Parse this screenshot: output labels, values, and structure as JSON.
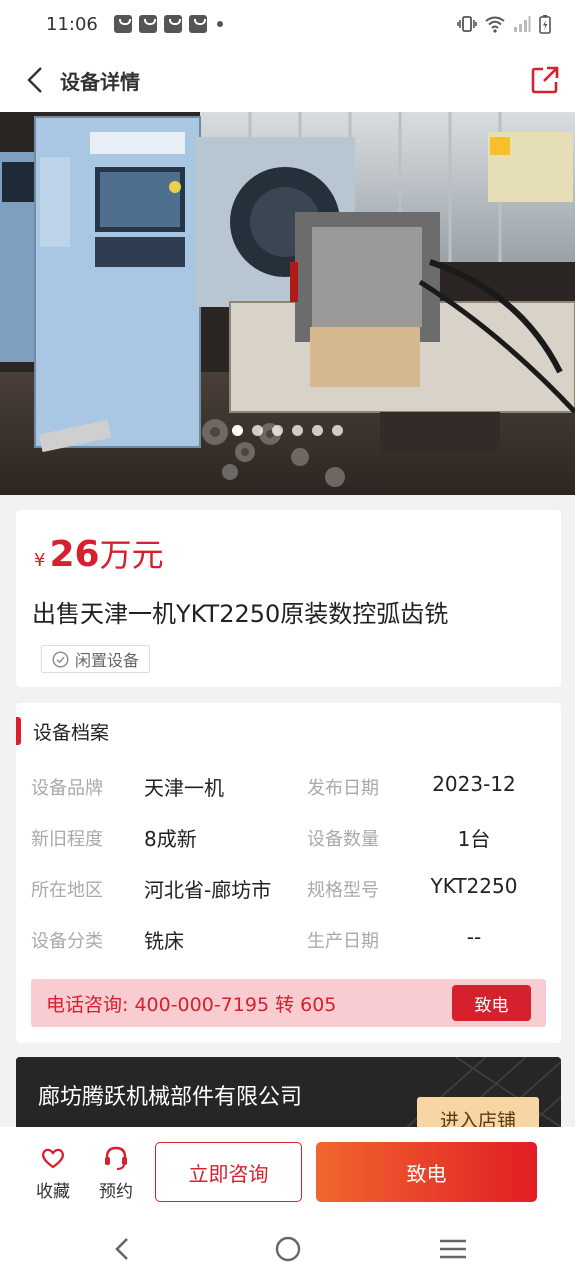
{
  "status_bar": {
    "time": "11:06"
  },
  "nav": {
    "title": "设备详情"
  },
  "gallery": {
    "image_count": 6,
    "active_index": 0
  },
  "listing": {
    "price_symbol": "¥",
    "price_value": "26",
    "price_unit": "万元",
    "title": "出售天津一机YKT2250原装数控弧齿铣",
    "tag": "闲置设备"
  },
  "profile": {
    "section_title": "设备档案",
    "rows": [
      {
        "label1": "设备品牌",
        "value1": "天津一机",
        "label2": "发布日期",
        "value2": "2023-12"
      },
      {
        "label1": "新旧程度",
        "value1": "8成新",
        "label2": "设备数量",
        "value2": "1台"
      },
      {
        "label1": "所在地区",
        "value1": "河北省-廊坊市",
        "label2": "规格型号",
        "value2": "YKT2250"
      },
      {
        "label1": "设备分类",
        "value1": "铣床",
        "label2": "生产日期",
        "value2": "--"
      }
    ],
    "phone_text": "电话咨询: 400-000-7195 转 605",
    "call_label": "致电"
  },
  "shop": {
    "name": "廊坊腾跃机械部件有限公司",
    "enter_label": "进入店铺"
  },
  "bottom_bar": {
    "favorite_label": "收藏",
    "reserve_label": "预约",
    "consult_label": "立即咨询",
    "call_label": "致电"
  },
  "colors": {
    "accent": "#d6202e",
    "phone_bg": "#f8ccd0",
    "call_gradient_start": "#f0672e",
    "call_gradient_end": "#e11d25"
  }
}
